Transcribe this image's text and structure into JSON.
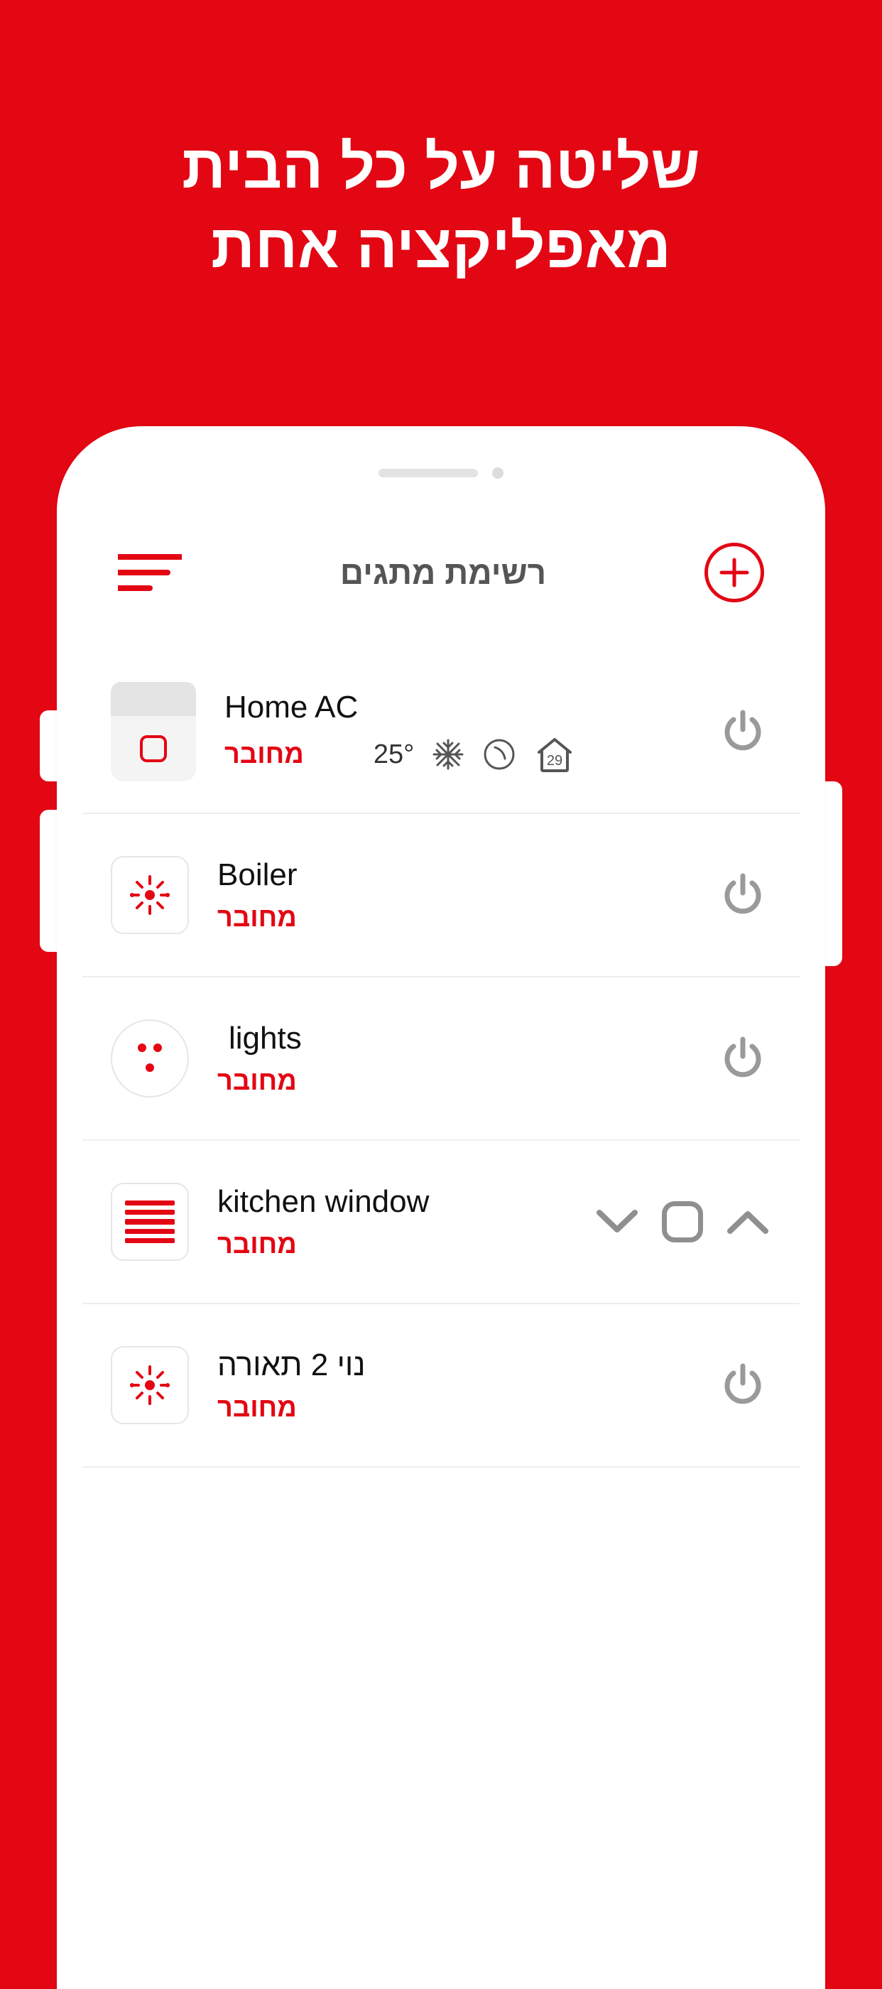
{
  "promo": {
    "line1": "שליטה על כל הבית",
    "line2": "מאפליקציה אחת"
  },
  "header": {
    "title": "רשימת מתגים"
  },
  "devices": [
    {
      "name": "Home AC",
      "status": "מחובר",
      "icon": "ac",
      "temp_set": "25°",
      "temp_indoor": "29",
      "control": "power"
    },
    {
      "name": "Boiler",
      "status": "מחובר",
      "icon": "sun",
      "control": "power"
    },
    {
      "name": "lights",
      "status": "מחובר",
      "icon": "dots",
      "control": "power"
    },
    {
      "name": "kitchen window",
      "status": "מחובר",
      "icon": "blinds",
      "control": "shutter"
    },
    {
      "name": "נוי 2 תאורה",
      "status": "מחובר",
      "icon": "sun",
      "control": "power"
    }
  ]
}
